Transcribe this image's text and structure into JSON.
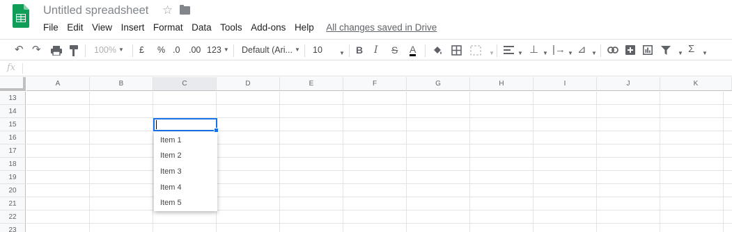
{
  "header": {
    "title": "Untitled spreadsheet",
    "star_icon": "star-icon",
    "folder_icon": "folder-icon",
    "save_status": "All changes saved in Drive"
  },
  "menu": [
    "File",
    "Edit",
    "View",
    "Insert",
    "Format",
    "Data",
    "Tools",
    "Add-ons",
    "Help"
  ],
  "toolbar": {
    "zoom": "100%",
    "currency": "£",
    "percent": "%",
    "decrease_decimals": ".0",
    "increase_decimals": ".00",
    "more_formats": "123",
    "font": "Default (Ari...",
    "font_size": "10",
    "bold": "B",
    "italic": "I",
    "strikethrough": "S",
    "text_color": "A",
    "function_symbol": "Σ"
  },
  "formula_bar": {
    "fx_label": "fx",
    "value": ""
  },
  "grid": {
    "columns": [
      "A",
      "B",
      "C",
      "D",
      "E",
      "F",
      "G",
      "H",
      "I",
      "J",
      "K"
    ],
    "rows": [
      "13",
      "14",
      "15",
      "16",
      "17",
      "18",
      "19",
      "20",
      "21",
      "22",
      "23"
    ],
    "selected_column": "C",
    "active_cell": "C15"
  },
  "dropdown": {
    "items": [
      "Item 1",
      "Item 2",
      "Item 3",
      "Item 4",
      "Item 5"
    ]
  },
  "colors": {
    "accent": "#1a73e8",
    "sheets_green": "#0f9d58",
    "header_bg": "#f8f9fa",
    "gridline": "#e2e3e3"
  }
}
